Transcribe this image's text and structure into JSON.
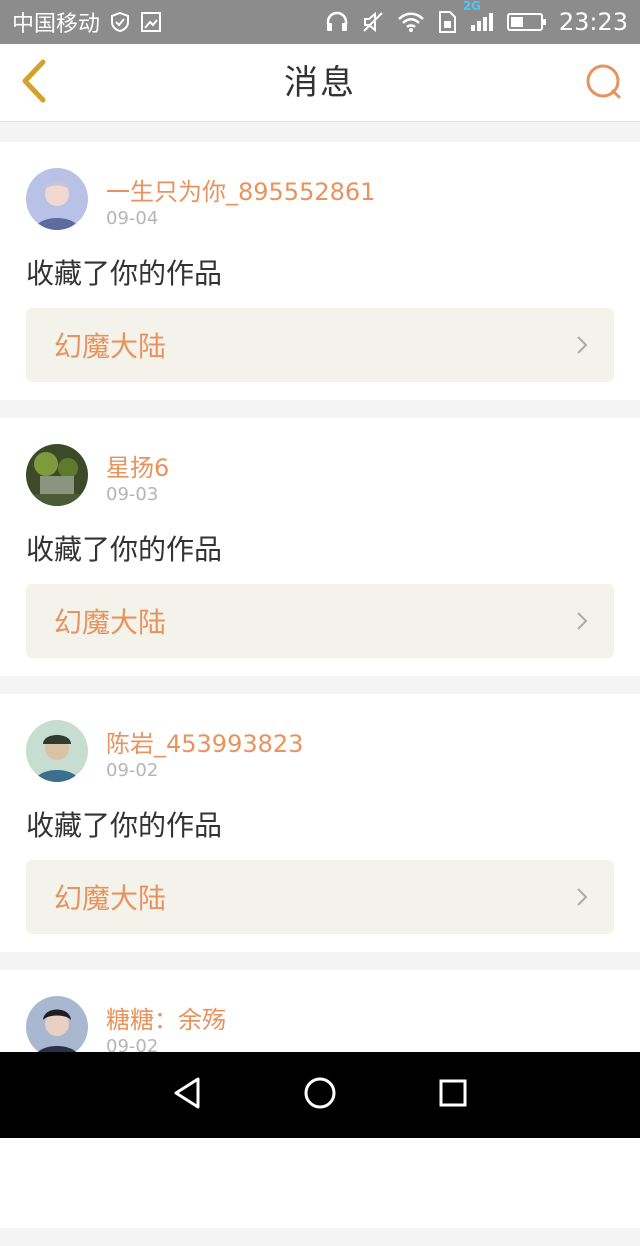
{
  "status_bar": {
    "carrier": "中国移动",
    "network": "2G",
    "time": "23:23",
    "icons": [
      "shield-check-icon",
      "image-icon",
      "headphones-icon",
      "mute-icon",
      "wifi-icon",
      "sim-icon",
      "signal-icon",
      "battery-icon"
    ]
  },
  "header": {
    "title": "消息",
    "back_icon": "chevron-left-icon",
    "search_icon": "search-icon",
    "accent_color": "#e8935e",
    "back_color": "#d4a22a"
  },
  "messages": [
    {
      "username": "一生只为你_895552861",
      "date": "09-04",
      "action": "收藏了你的作品",
      "work": "幻魔大陆"
    },
    {
      "username": "星扬6",
      "date": "09-03",
      "action": "收藏了你的作品",
      "work": "幻魔大陆"
    },
    {
      "username": "陈岩_453993823",
      "date": "09-02",
      "action": "收藏了你的作品",
      "work": "幻魔大陆"
    },
    {
      "username": "糖糖：余殇",
      "date": "09-02",
      "action": "",
      "work": ""
    }
  ],
  "nav_bar": {
    "icons": [
      "back-triangle-icon",
      "home-circle-icon",
      "recents-square-icon"
    ]
  }
}
